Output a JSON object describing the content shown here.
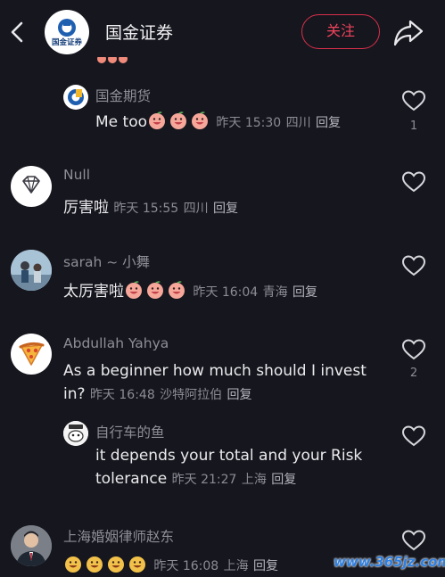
{
  "header": {
    "title": "国金证券",
    "follow_label": "关注",
    "logo_text": "国金证券"
  },
  "comments": [
    {
      "replies": [
        {
          "name": "国金期货",
          "text": "Me too",
          "time": "昨天 15:30",
          "location": "四川",
          "reply_label": "回复",
          "emojis": 3,
          "likes": "1"
        }
      ]
    },
    {
      "name": "Null",
      "text": "厉害啦",
      "time": "昨天 15:55",
      "location": "四川",
      "reply_label": "回复",
      "emojis": 0,
      "likes": ""
    },
    {
      "name": "sarah ~ 小舞",
      "text": "太厉害啦",
      "time": "昨天 16:04",
      "location": "青海",
      "reply_label": "回复",
      "emojis": 3,
      "likes": ""
    },
    {
      "name": "Abdullah Yahya",
      "text_line1": "As a beginner how much should I invest",
      "text_line2": "in?",
      "time": "昨天 16:48",
      "location": "沙特阿拉伯",
      "reply_label": "回复",
      "likes": "2",
      "replies": [
        {
          "name": "自行车的鱼",
          "text_line1": "it depends your total and your Risk",
          "text_line2": "tolerance",
          "time": "昨天 21:27",
          "location": "上海",
          "reply_label": "回复",
          "likes": ""
        }
      ]
    },
    {
      "name": "上海婚姻律师赵东",
      "text": "",
      "time": "昨天 16:08",
      "location": "上海",
      "reply_label": "回复",
      "emojis": 4,
      "likes": ""
    }
  ],
  "watermark": "www.365jz.com",
  "colors": {
    "background": "#16161e",
    "accent": "#f0435c",
    "muted": "#8c8c94"
  }
}
